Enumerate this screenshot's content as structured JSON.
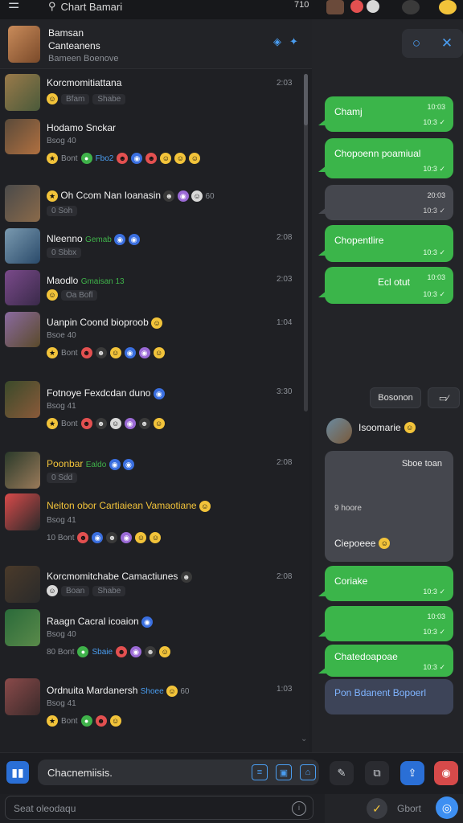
{
  "topbar": {
    "menu_icon": "hamburger-menu-icon",
    "search_icon": "search-icon",
    "title": "Chart Bamari",
    "right_text": "710",
    "colors": {
      "red": "#e35050",
      "yellow": "#f2c33a"
    }
  },
  "chat_header": {
    "name": "Bamsan",
    "subtitle": "Canteanens",
    "status": "Bameen Boenove"
  },
  "conversations": [
    {
      "name": "Korcmomitiattana",
      "time": "2:03",
      "preview": "Bfam",
      "tag": "Shabe"
    },
    {
      "name": "Hodamo Snckar",
      "time": "",
      "preview": "Bsog 40",
      "tag": ""
    },
    {
      "name": "Oh Ccom Nan Ioanasin",
      "time": "",
      "preview": "0 Soh",
      "tag": "60"
    },
    {
      "name": "Nleenno",
      "time": "2:08",
      "preview": "0 Sbbx",
      "tag": "Gemab"
    },
    {
      "name": "Maodlo",
      "time": "2:03",
      "preview": "Oa Bofl",
      "tag": "Gmaisan 13"
    },
    {
      "name": "Uanpin Coond bioproob",
      "time": "1:04",
      "preview": "Bsoe 40",
      "tag": ""
    },
    {
      "name": "Fotnoye Fexdcdan duno",
      "time": "3:30",
      "preview": "Bsog 41",
      "tag": ""
    },
    {
      "name": "Poonbar",
      "time": "2:08",
      "preview": "0 Sdd",
      "tag": "Ealdo"
    },
    {
      "name": "Neiton obor Cartiaiean Vamaotiane",
      "time": "",
      "preview": "Bsog 41",
      "tag": ""
    },
    {
      "name": "Korcmomitchabe Camactiunes",
      "time": "2:08",
      "preview": "Boan",
      "tag": "Shabe"
    },
    {
      "name": "Raagn Cacral icoaion",
      "time": "",
      "preview": "Bsog 40",
      "tag": ""
    },
    {
      "name": "Ordnuita Mardanersh",
      "time": "1:03",
      "preview": "Bsog 41",
      "tag": "60"
    }
  ],
  "line2_extras": {
    "feed_label_1": "Bont",
    "feed_label_2": "Fbo2",
    "feed_label_3": "10 Bont",
    "feed_label_4": "80 Bont",
    "feed_label_5": "Sbaie",
    "feed_label_6": "Shoee"
  },
  "messages": [
    {
      "text": "Chamj",
      "meta": "10:03",
      "stamp": "10:3"
    },
    {
      "text": "Chopoenn poamiual",
      "meta": "",
      "stamp": "10:3"
    },
    {
      "text": "",
      "meta": "20:03",
      "stamp": "10:3"
    },
    {
      "text": "Chopentlire",
      "meta": "",
      "stamp": "10:3"
    },
    {
      "text": "Ecl otut",
      "meta": "10:03",
      "stamp": "10:3"
    }
  ],
  "right_actions": {
    "chip1": "Bosonon",
    "chip2": "ID"
  },
  "sender": {
    "name": "Isoomarie"
  },
  "card": {
    "top": "Sboe toan",
    "mid": "9 hoore",
    "bottom": "Ciepoeee"
  },
  "later_messages": [
    {
      "text": "Coriake",
      "stamp": "10:3"
    },
    {
      "text": "",
      "meta": "10:03",
      "stamp": "10:3"
    },
    {
      "text": "Chatedoapoae",
      "stamp": "10:3"
    }
  ],
  "blue_message": {
    "text": "Pon Bdanent Bopoerl"
  },
  "composer": {
    "placeholder": "Chacnemiisis."
  },
  "search": {
    "placeholder": "Seat oleodaqu"
  },
  "bottom_right": {
    "label": "Gbort"
  }
}
